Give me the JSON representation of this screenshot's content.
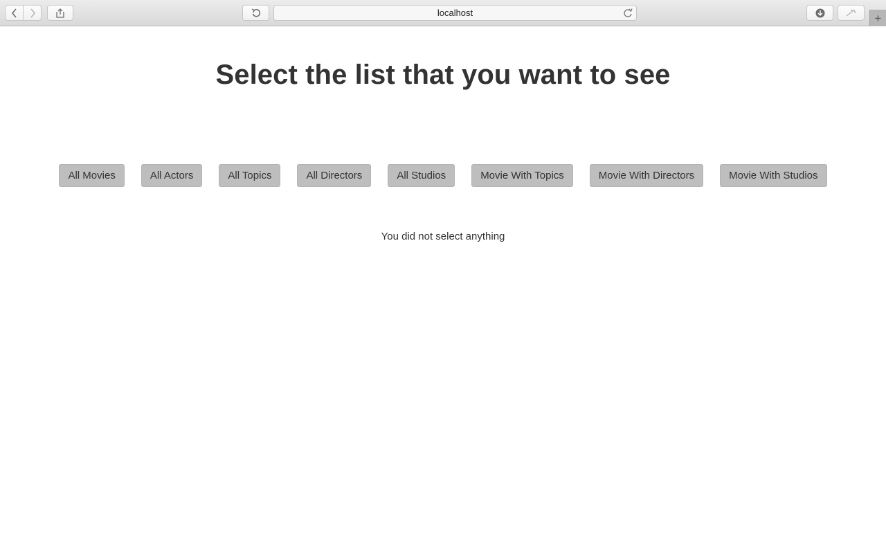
{
  "browser": {
    "url": "localhost",
    "newtab_glyph": "+"
  },
  "page": {
    "title": "Select the list that you want to see",
    "buttons": [
      "All Movies",
      "All Actors",
      "All Topics",
      "All Directors",
      "All Studios",
      "Movie With Topics",
      "Movie With Directors",
      "Movie With Studios"
    ],
    "message": "You did not select anything"
  }
}
